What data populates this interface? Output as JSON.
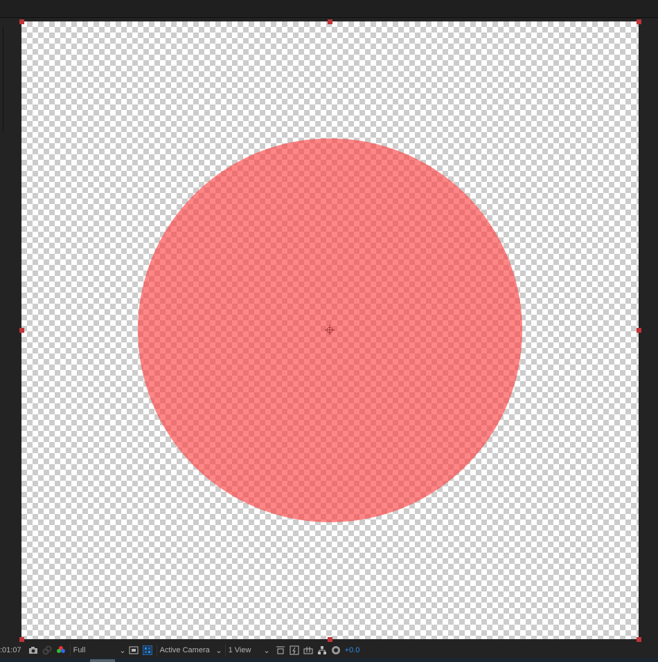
{
  "viewer": {
    "layer_color": "#ff3c3c",
    "shape": "circle"
  },
  "toolbar": {
    "timecode": ":01:07",
    "resolution": "Full",
    "view_camera": "Active Camera",
    "view_layout": "1 View",
    "exposure": "+0.0",
    "exposure_color": "#2d8ceb"
  }
}
